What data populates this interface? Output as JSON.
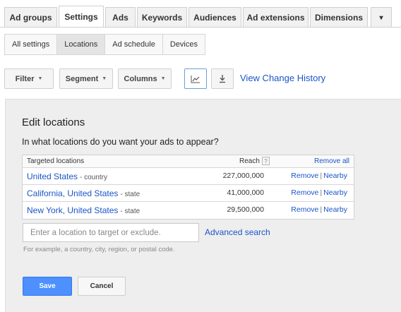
{
  "top_tabs": [
    {
      "label": "Ad groups"
    },
    {
      "label": "Settings"
    },
    {
      "label": "Ads"
    },
    {
      "label": "Keywords"
    },
    {
      "label": "Audiences"
    },
    {
      "label": "Ad extensions"
    },
    {
      "label": "Dimensions"
    },
    {
      "label": "▾"
    }
  ],
  "sub_tabs": [
    {
      "label": "All settings"
    },
    {
      "label": "Locations"
    },
    {
      "label": "Ad schedule"
    },
    {
      "label": "Devices"
    }
  ],
  "toolbar": {
    "filter_label": "Filter",
    "segment_label": "Segment",
    "columns_label": "Columns",
    "chart_icon": "line-chart-icon",
    "download_icon": "download-icon",
    "change_history_label": "View Change History"
  },
  "panel": {
    "title": "Edit locations",
    "question": "In what locations do you want your ads to appear?",
    "table": {
      "col_location": "Targeted locations",
      "col_reach": "Reach",
      "help_glyph": "?",
      "remove_all_label": "Remove all",
      "rows": [
        {
          "name": "United States",
          "type": "- country",
          "reach": "227,000,000",
          "remove": "Remove",
          "nearby": "Nearby"
        },
        {
          "name": "California, United States",
          "type": "- state",
          "reach": "41,000,000",
          "remove": "Remove",
          "nearby": "Nearby"
        },
        {
          "name": "New York, United States",
          "type": "- state",
          "reach": "29,500,000",
          "remove": "Remove",
          "nearby": "Nearby"
        }
      ]
    },
    "search": {
      "placeholder": "Enter a location to target or exclude.",
      "advanced_label": "Advanced search",
      "hint": "For example, a country, city, region, or postal code."
    },
    "save_label": "Save",
    "cancel_label": "Cancel"
  },
  "colors": {
    "link": "#1a55c7",
    "primary_button": "#4d90fe",
    "panel_bg": "#eeeeee"
  }
}
